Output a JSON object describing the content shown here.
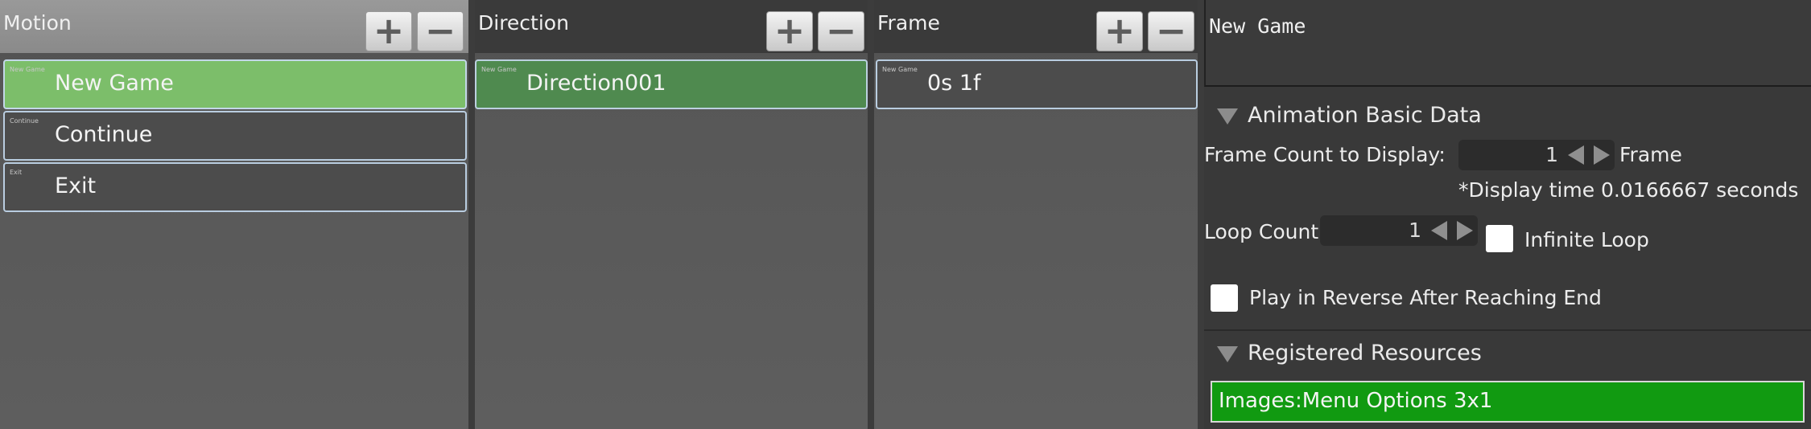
{
  "motion": {
    "title": "Motion",
    "items": [
      {
        "thumb": "New Game",
        "label": "New Game"
      },
      {
        "thumb": "Continue",
        "label": "Continue"
      },
      {
        "thumb": "Exit",
        "label": "Exit"
      }
    ]
  },
  "direction": {
    "title": "Direction",
    "items": [
      {
        "thumb": "New Game",
        "label": "Direction001"
      }
    ]
  },
  "frame": {
    "title": "Frame",
    "items": [
      {
        "thumb": "New Game",
        "label": "0s 1f"
      }
    ]
  },
  "buttons": {
    "add": "+",
    "remove": "−"
  },
  "right": {
    "name": "New Game",
    "animation_section": "Animation Basic Data",
    "frame_count_label": "Frame Count to Display:",
    "frame_count_value": "1",
    "frame_unit": "Frame",
    "display_time_note": "*Display time 0.0166667 seconds",
    "loop_count_label": "Loop Count",
    "loop_count_value": "1",
    "infinite_loop_label": "Infinite Loop",
    "infinite_loop_checked": false,
    "reverse_label": "Play in Reverse After Reaching End",
    "reverse_checked": false,
    "resources_section": "Registered Resources",
    "resource_item": "Images:Menu Options 3x1"
  },
  "colors": {
    "selected_item": "#7cbe6a",
    "direction_selected": "#4f8a4f",
    "resource_bg": "#119a11"
  }
}
